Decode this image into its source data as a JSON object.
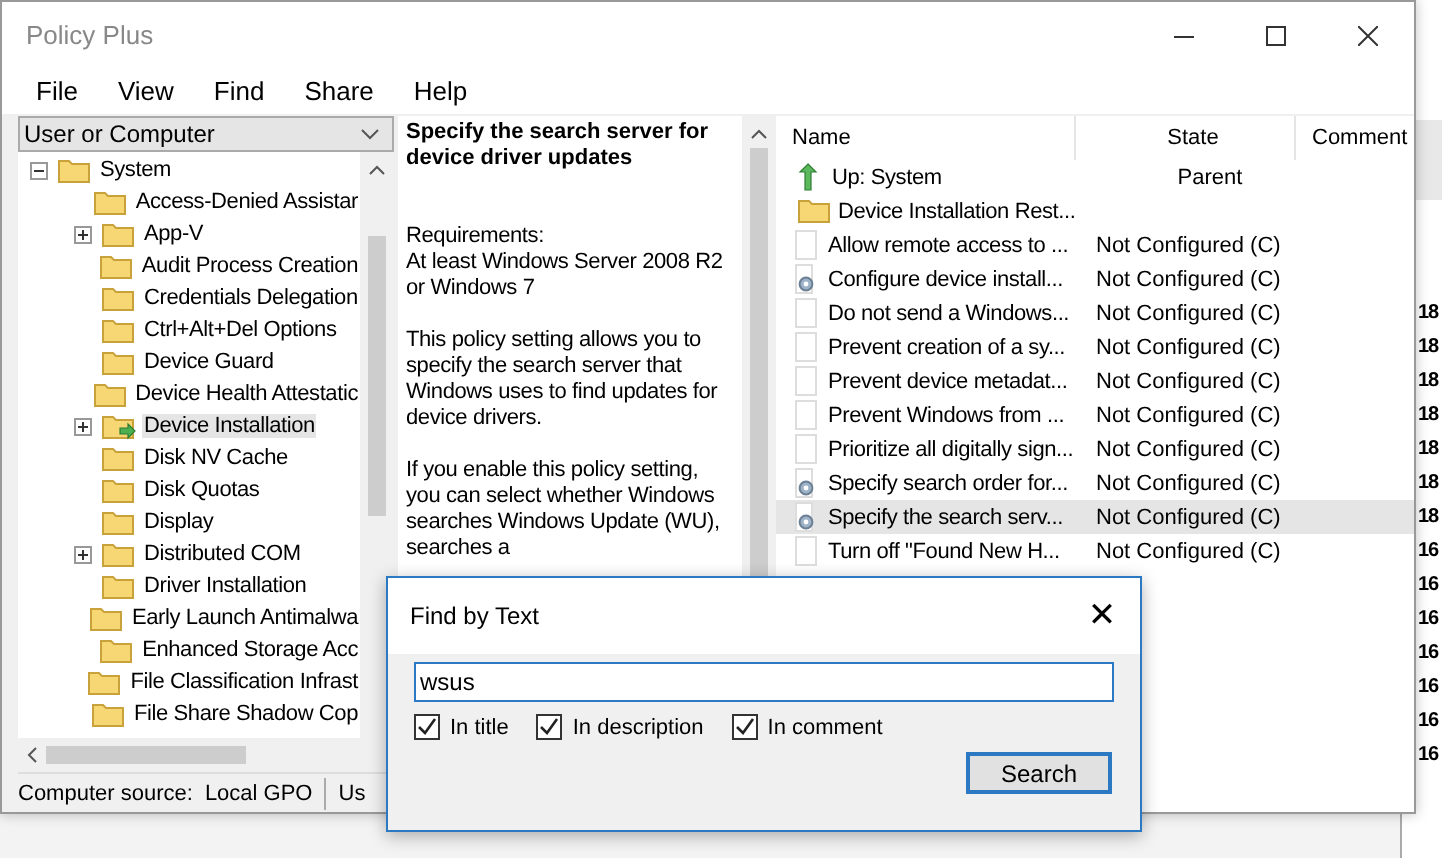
{
  "window": {
    "title": "Policy Plus"
  },
  "menu": [
    "File",
    "View",
    "Find",
    "Share",
    "Help"
  ],
  "scope_dropdown": {
    "value": "User or Computer"
  },
  "tree": [
    {
      "label": "System",
      "kind": "expanded",
      "selected": false,
      "children": [
        {
          "label": "Access-Denied Assistar",
          "kind": "leaf",
          "selected": false
        },
        {
          "label": "App-V",
          "kind": "collapsed",
          "selected": false
        },
        {
          "label": "Audit Process Creation",
          "kind": "leaf",
          "selected": false
        },
        {
          "label": "Credentials Delegation",
          "kind": "leaf",
          "selected": false
        },
        {
          "label": "Ctrl+Alt+Del Options",
          "kind": "leaf",
          "selected": false
        },
        {
          "label": "Device Guard",
          "kind": "leaf",
          "selected": false
        },
        {
          "label": "Device Health Attestatic",
          "kind": "leaf",
          "selected": false
        },
        {
          "label": "Device Installation",
          "kind": "collapsed",
          "selected": true
        },
        {
          "label": "Disk NV Cache",
          "kind": "leaf",
          "selected": false
        },
        {
          "label": "Disk Quotas",
          "kind": "leaf",
          "selected": false
        },
        {
          "label": "Display",
          "kind": "leaf",
          "selected": false
        },
        {
          "label": "Distributed COM",
          "kind": "collapsed",
          "selected": false
        },
        {
          "label": "Driver Installation",
          "kind": "leaf",
          "selected": false
        },
        {
          "label": "Early Launch Antimalwa",
          "kind": "leaf",
          "selected": false
        },
        {
          "label": "Enhanced Storage Acc",
          "kind": "leaf",
          "selected": false
        },
        {
          "label": "File Classification Infrast",
          "kind": "leaf",
          "selected": false
        },
        {
          "label": "File Share Shadow Cop",
          "kind": "leaf",
          "selected": false
        }
      ]
    }
  ],
  "description": {
    "title": "Specify the search server for device driver updates",
    "paragraphs": [
      "Requirements:\nAt least Windows Server 2008 R2 or Windows 7",
      "This policy setting allows you to specify the search server that Windows uses to find updates for device drivers.",
      "If you enable this policy setting, you can select whether Windows searches Windows Update (WU), searches a"
    ]
  },
  "list": {
    "columns": [
      "Name",
      "State",
      "Comment"
    ],
    "rows": [
      {
        "kind": "up",
        "name": "Up: System",
        "state": "Parent",
        "selected": false
      },
      {
        "kind": "folder",
        "name": "Device Installation Rest...",
        "selected": false
      },
      {
        "kind": "policy",
        "name": "Allow remote access to ...",
        "state": "Not Configured (C)",
        "selected": false
      },
      {
        "kind": "options",
        "name": "Configure device install...",
        "state": "Not Configured (C)",
        "selected": false
      },
      {
        "kind": "policy",
        "name": "Do not send a Windows...",
        "state": "Not Configured (C)",
        "selected": false
      },
      {
        "kind": "policy",
        "name": "Prevent creation of a sy...",
        "state": "Not Configured (C)",
        "selected": false
      },
      {
        "kind": "policy",
        "name": "Prevent device metadat...",
        "state": "Not Configured (C)",
        "selected": false
      },
      {
        "kind": "policy",
        "name": "Prevent Windows from ...",
        "state": "Not Configured (C)",
        "selected": false
      },
      {
        "kind": "policy",
        "name": "Prioritize all digitally sign...",
        "state": "Not Configured (C)",
        "selected": false
      },
      {
        "kind": "options",
        "name": "Specify search order for...",
        "state": "Not Configured (C)",
        "selected": false
      },
      {
        "kind": "options",
        "name": "Specify the search serv...",
        "state": "Not Configured (C)",
        "selected": true
      },
      {
        "kind": "policy",
        "name": "Turn off \"Found New H...",
        "state": "Not Configured (C)",
        "selected": false
      }
    ]
  },
  "status_bar": [
    "Computer source:",
    "Local GPO",
    "Us"
  ],
  "background_window": {
    "column_1": [
      "18",
      "18",
      "18",
      "18",
      "18",
      "18",
      "18",
      "16",
      "16",
      "16",
      "16",
      "16",
      "16",
      "16"
    ]
  },
  "find_dialog": {
    "title": "Find by Text",
    "close": "✕",
    "search_text": "wsus",
    "options": [
      {
        "label": "In title",
        "checked": true
      },
      {
        "label": "In description",
        "checked": true
      },
      {
        "label": "In comment",
        "checked": true
      }
    ],
    "button": "Search"
  }
}
